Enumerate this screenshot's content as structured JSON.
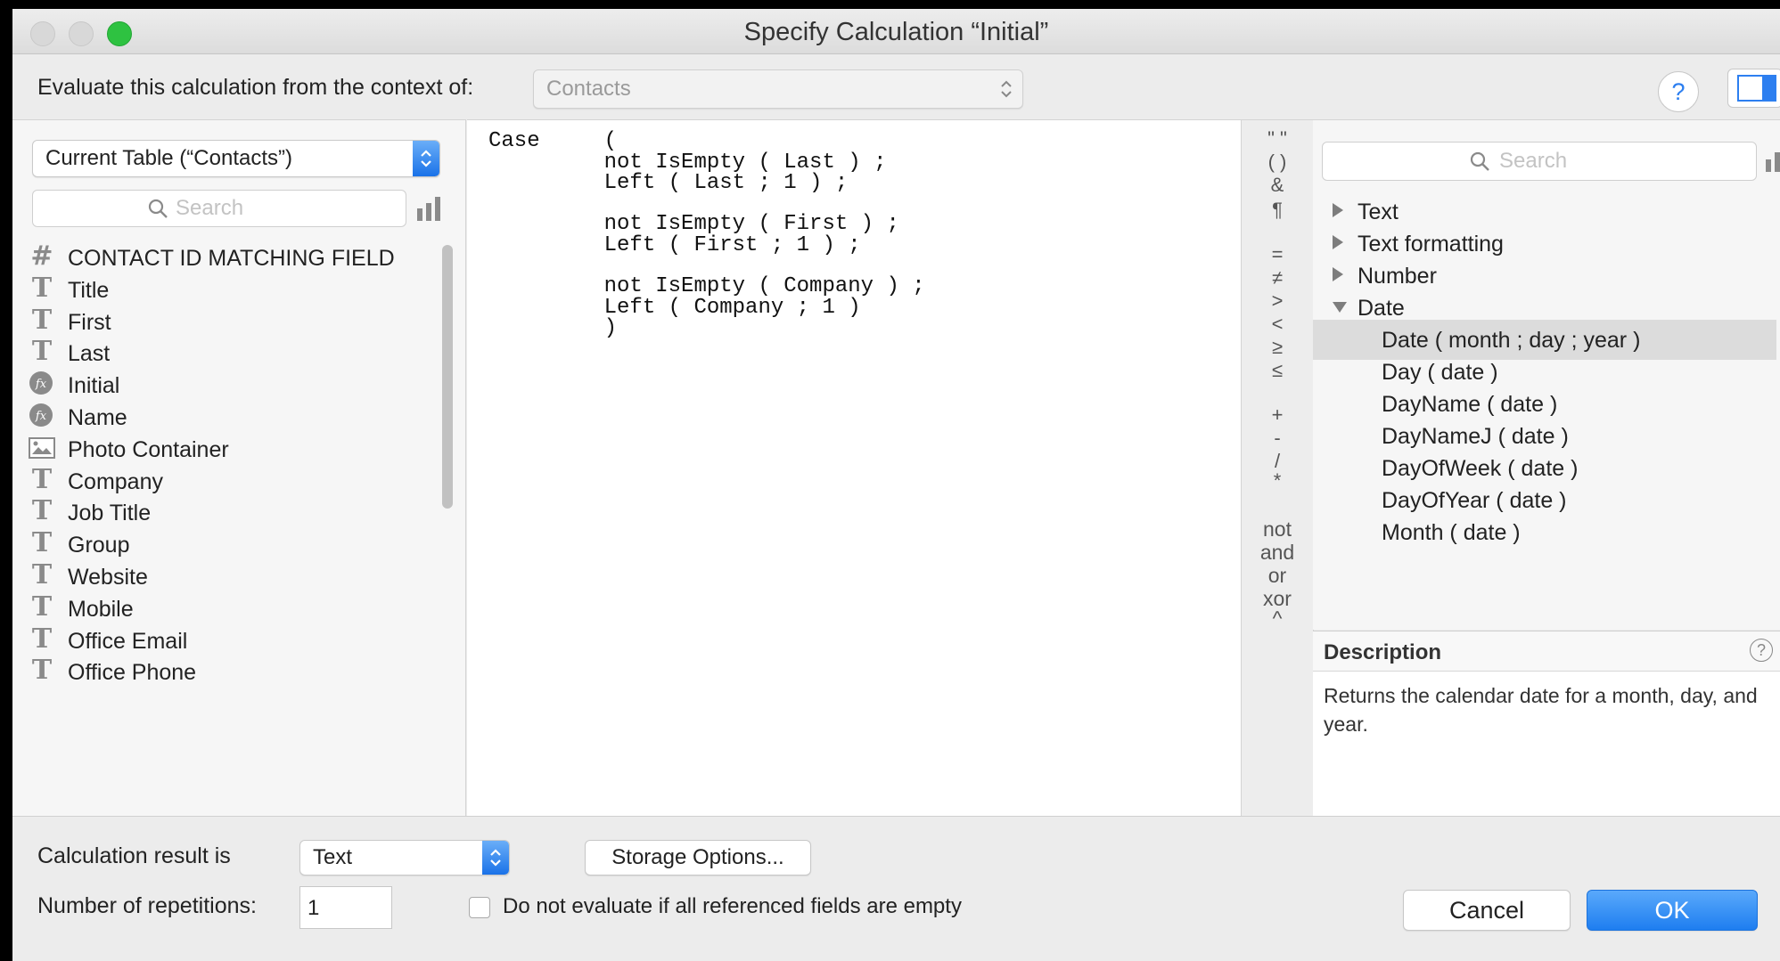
{
  "window": {
    "title": "Specify Calculation “Initial”"
  },
  "context": {
    "label": "Evaluate this calculation from the context of:",
    "value": "Contacts"
  },
  "fields": {
    "table_select": "Current Table (“Contacts”)",
    "search_placeholder": "Search",
    "items": [
      {
        "name": "CONTACT ID MATCHING FIELD",
        "icon": "number-field-icon"
      },
      {
        "name": "Title",
        "icon": "text-field-icon"
      },
      {
        "name": "First",
        "icon": "text-field-icon"
      },
      {
        "name": "Last",
        "icon": "text-field-icon"
      },
      {
        "name": "Initial",
        "icon": "calculation-field-icon"
      },
      {
        "name": "Name",
        "icon": "calculation-field-icon"
      },
      {
        "name": "Photo Container",
        "icon": "container-field-icon"
      },
      {
        "name": "Company",
        "icon": "text-field-icon"
      },
      {
        "name": "Job Title",
        "icon": "text-field-icon"
      },
      {
        "name": "Group",
        "icon": "text-field-icon"
      },
      {
        "name": "Website",
        "icon": "text-field-icon"
      },
      {
        "name": "Mobile",
        "icon": "text-field-icon"
      },
      {
        "name": "Office Email",
        "icon": "text-field-icon"
      },
      {
        "name": "Office Phone",
        "icon": "text-field-icon"
      }
    ]
  },
  "formula": {
    "lines": [
      "Case     (",
      "         not IsEmpty ( Last ) ;",
      "         Left ( Last ; 1 ) ;",
      "",
      "         not IsEmpty ( First ) ;",
      "         Left ( First ; 1 ) ;",
      "",
      "         not IsEmpty ( Company ) ;",
      "         Left ( Company ; 1 )",
      "         )"
    ]
  },
  "operators": {
    "symbols": [
      "\" \"",
      "( )",
      "&",
      "¶",
      "=",
      "≠",
      ">",
      "<",
      "≥",
      "≤",
      "+",
      "-",
      "/",
      "*"
    ],
    "words": [
      "not",
      "and",
      "or",
      "xor",
      "^"
    ]
  },
  "functions": {
    "search_placeholder": "Search",
    "categories": [
      {
        "name": "Text",
        "expanded": false
      },
      {
        "name": "Text formatting",
        "expanded": false
      },
      {
        "name": "Number",
        "expanded": false
      },
      {
        "name": "Date",
        "expanded": true
      }
    ],
    "items": [
      "Date ( month ; day ; year )",
      "Day ( date )",
      "DayName ( date )",
      "DayNameJ ( date )",
      "DayOfWeek ( date )",
      "DayOfYear ( date )",
      "Month ( date )"
    ],
    "selected_index": 0
  },
  "description": {
    "title": "Description",
    "text": "Returns the calendar date for a month, day, and year."
  },
  "result": {
    "label": "Calculation result is",
    "value": "Text"
  },
  "storage_button": "Storage Options...",
  "repetitions": {
    "label": "Number of repetitions:",
    "value": "1"
  },
  "do_not_evaluate": {
    "label": "Do not evaluate if all referenced fields are empty",
    "checked": false
  },
  "buttons": {
    "cancel": "Cancel",
    "ok": "OK"
  },
  "colors": {
    "accent": "#1e7ef0",
    "window_bg": "#ececec",
    "close": "#d8d8d8",
    "zoom": "#2ec241"
  }
}
